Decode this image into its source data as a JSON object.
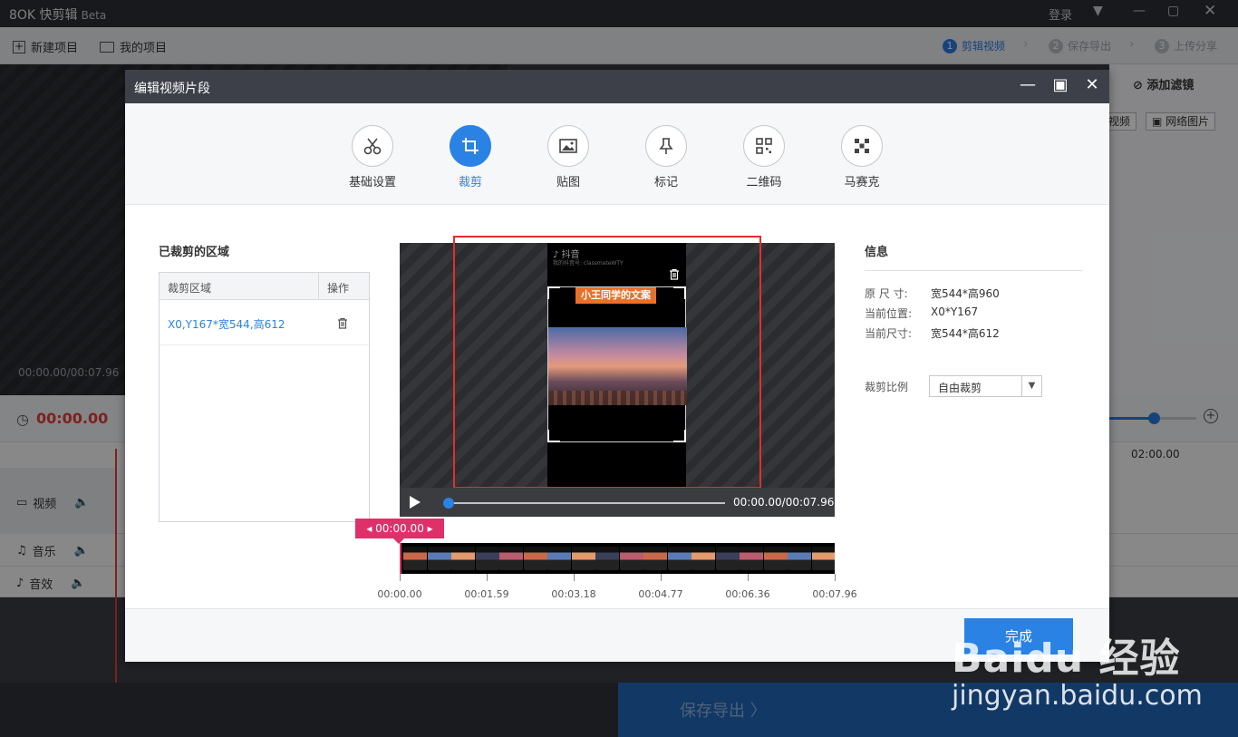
{
  "app": {
    "logo_text": "8OK 快剪辑",
    "beta": "Beta"
  },
  "window_controls": {
    "login": "登录"
  },
  "toolbar": {
    "new_project": "新建项目",
    "my_projects": "我的项目"
  },
  "steps": [
    {
      "num": "1",
      "label": "剪辑视频"
    },
    {
      "num": "2",
      "label": "保存导出"
    },
    {
      "num": "3",
      "label": "上传分享"
    }
  ],
  "preview_bg": {
    "time": "00:00.00/00:07.96"
  },
  "right_panel": {
    "filter": "添加滤镜",
    "video_btn": "视频",
    "net_img_btn": "网络图片"
  },
  "timeline": {
    "time": "00:00.00",
    "ruler_label": "02:00.00",
    "tracks": [
      {
        "label": "视频"
      },
      {
        "label": "音乐"
      },
      {
        "label": "音效"
      }
    ]
  },
  "save_export": "保存导出 〉",
  "dialog": {
    "title": "编辑视频片段",
    "tools": [
      {
        "label": "基础设置",
        "icon": "scissors-icon"
      },
      {
        "label": "裁剪",
        "icon": "crop-icon"
      },
      {
        "label": "贴图",
        "icon": "image-icon"
      },
      {
        "label": "标记",
        "icon": "pin-icon"
      },
      {
        "label": "二维码",
        "icon": "qrcode-icon"
      },
      {
        "label": "马赛克",
        "icon": "mosaic-icon"
      }
    ],
    "cropped": {
      "title": "已裁剪的区域",
      "col_region": "裁剪区域",
      "col_op": "操作",
      "rows": [
        {
          "region": "X0,Y167*宽544,高612"
        }
      ]
    },
    "video": {
      "app_logo": "抖音",
      "account": "我的抖音号: classmateWTY",
      "caption": "小王同学的文案"
    },
    "player": {
      "time": "00:00.00/00:07.96",
      "progress": 0
    },
    "time_tag": "00:00.00",
    "ticks": [
      "00:00.00",
      "00:01.59",
      "00:03.18",
      "00:04.77",
      "00:06.36",
      "00:07.96"
    ],
    "info": {
      "title": "信息",
      "orig_label": "原 尺 寸:",
      "orig_value": "宽544*高960",
      "pos_label": "当前位置:",
      "pos_value": "X0*Y167",
      "size_label": "当前尺寸:",
      "size_value": "宽544*高612",
      "ratio_label": "裁剪比例",
      "ratio_value": "自由裁剪"
    },
    "done": "完成"
  },
  "watermark": {
    "brand": "Baidu 经验",
    "url": "jingyan.baidu.com"
  }
}
